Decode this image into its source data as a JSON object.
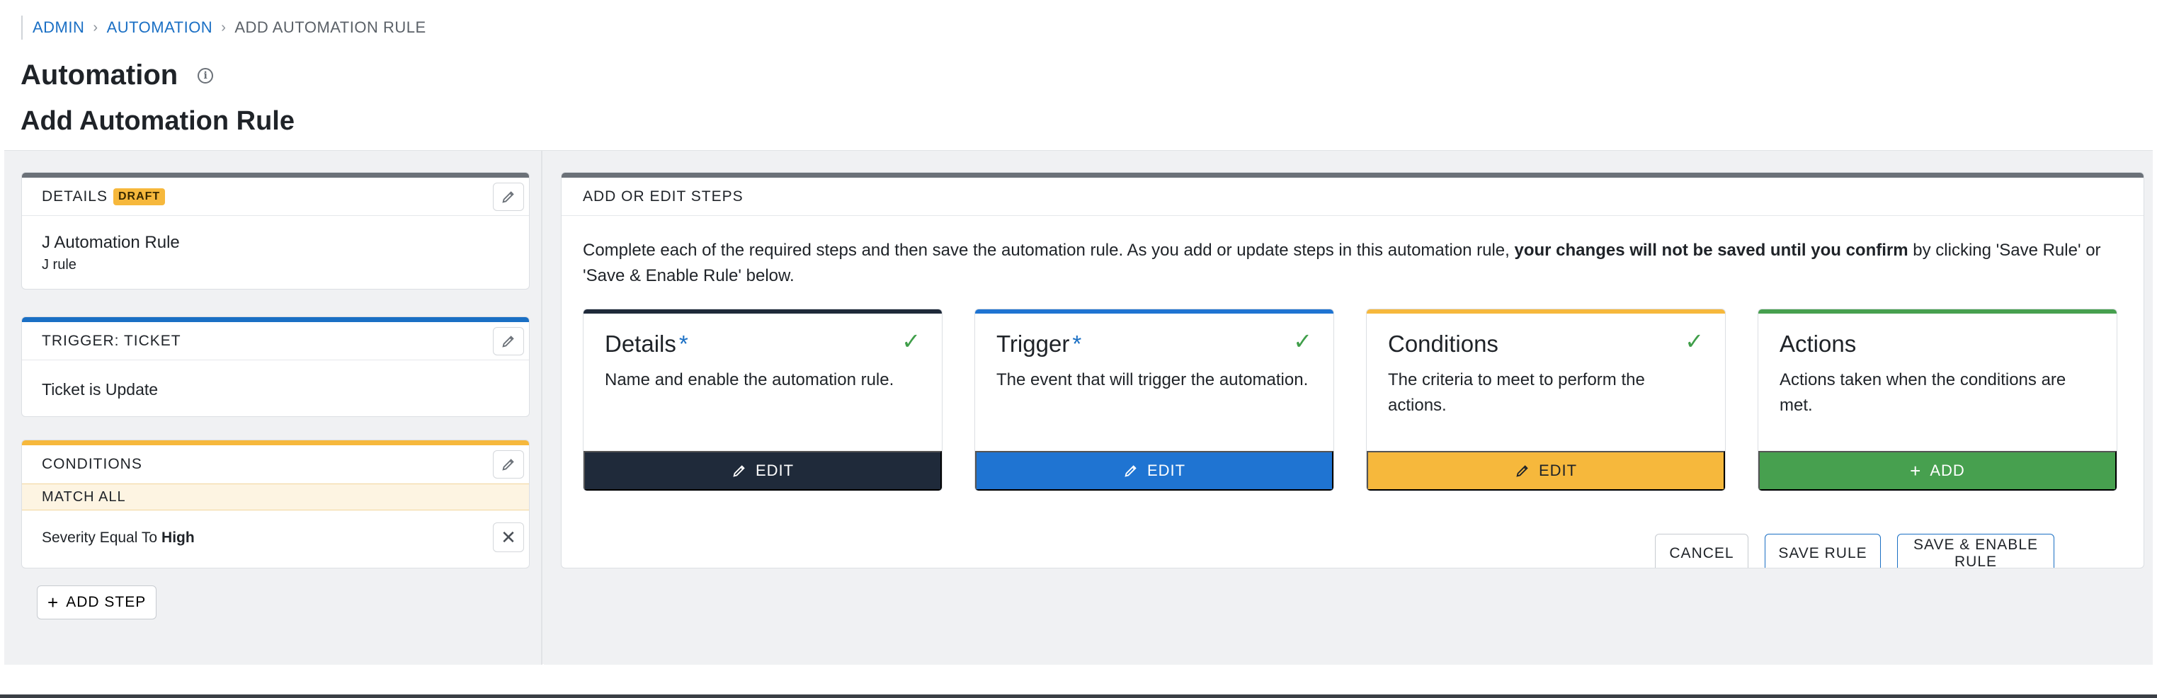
{
  "breadcrumb": {
    "items": [
      "ADMIN",
      "AUTOMATION"
    ],
    "current": "ADD AUTOMATION RULE"
  },
  "page": {
    "title": "Automation",
    "subtitle": "Add Automation Rule"
  },
  "sidebar": {
    "details": {
      "label": "DETAILS",
      "badge": "DRAFT",
      "name": "J Automation Rule",
      "description": "J rule",
      "accent": "#6b7178"
    },
    "trigger": {
      "label": "TRIGGER: TICKET",
      "value": "Ticket is Update",
      "accent": "#1a6fc4"
    },
    "conditions": {
      "label": "CONDITIONS",
      "match": "MATCH ALL",
      "row_prefix": "Severity Equal To",
      "row_value": "High",
      "accent": "#f6b83c"
    },
    "add_step": "ADD STEP"
  },
  "steps_panel": {
    "title": "ADD OR EDIT STEPS",
    "intro_start": "Complete each of the required steps and then save the automation rule. As you add or update steps in this automation rule,",
    "intro_bold": "your changes will not be saved until you confirm",
    "intro_end": "by clicking 'Save Rule' or 'Save & Enable Rule' below.",
    "steps": [
      {
        "title": "Details",
        "required": "*",
        "desc": "Name and enable the automation rule.",
        "action": "EDIT",
        "color": "#1f2a3a"
      },
      {
        "title": "Trigger",
        "required": "*",
        "desc": "The event that will trigger the automation.",
        "action": "EDIT",
        "color": "#1f74d2"
      },
      {
        "title": "Conditions",
        "required": "",
        "desc": "The criteria to meet to perform the actions.",
        "action": "EDIT",
        "color": "#f6b83c"
      },
      {
        "title": "Actions",
        "required": "",
        "desc": "Actions taken when the conditions are met.",
        "action": "ADD",
        "color": "#47a04f"
      }
    ],
    "buttons": {
      "cancel": "CANCEL",
      "save": "SAVE RULE",
      "save_enable": "SAVE & ENABLE RULE"
    }
  },
  "icons": {
    "edit": "pencil-icon",
    "check": "check-icon",
    "remove": "close-icon",
    "add": "plus-icon",
    "info": "info-icon"
  }
}
